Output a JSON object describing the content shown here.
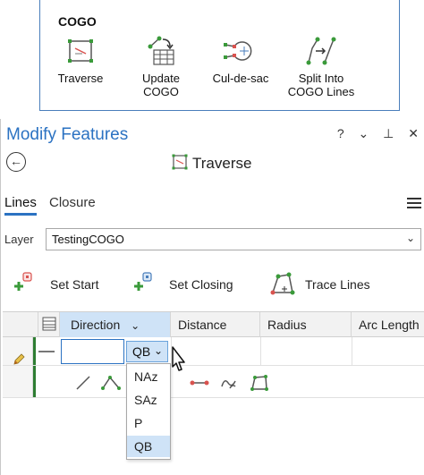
{
  "ribbon": {
    "group_title": "COGO",
    "tools": [
      {
        "label": "Traverse",
        "icon": "traverse-icon"
      },
      {
        "label": "Update\nCOGO",
        "icon": "update-cogo-icon"
      },
      {
        "label": "Cul-de-sac",
        "icon": "cul-de-sac-icon"
      },
      {
        "label": "Split Into\nCOGO Lines",
        "icon": "split-into-cogo-lines-icon"
      }
    ]
  },
  "pane": {
    "title": "Modify Features",
    "controls": {
      "help": "?",
      "options": "⌄",
      "pin": "⊥",
      "close": "✕"
    },
    "back_icon": "back-arrow-icon",
    "tool_name": "Traverse",
    "tabs": [
      {
        "label": "Lines",
        "active": true
      },
      {
        "label": "Closure",
        "active": false
      }
    ],
    "layer_label": "Layer",
    "layer_value": "TestingCOGO",
    "actions": [
      {
        "label": "Set Start",
        "icon": "set-start-icon"
      },
      {
        "label": "Set Closing",
        "icon": "set-closing-icon"
      },
      {
        "label": "Trace Lines",
        "icon": "trace-lines-icon"
      }
    ]
  },
  "grid": {
    "columns": [
      "Direction",
      "Distance",
      "Radius",
      "Arc Length"
    ],
    "selected_column": "Direction",
    "direction_value": "",
    "direction_format": "QB",
    "format_options": [
      "NAz",
      "SAz",
      "P",
      "QB"
    ],
    "selected_option": "QB"
  },
  "colors": {
    "accent": "#2b72c2",
    "selection": "#cfe3f7",
    "edit_bar": "#2e7d32",
    "tool_green": "#3a9a3a",
    "tool_red": "#d9534f"
  }
}
